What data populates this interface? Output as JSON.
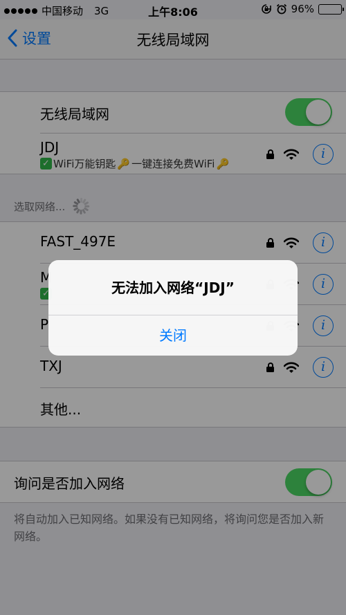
{
  "status_bar": {
    "carrier": "中国移动",
    "network": "3G",
    "time": "上午8:06",
    "battery": "96%",
    "battery_level": 0.96
  },
  "nav": {
    "back_label": "设置",
    "title": "无线局域网"
  },
  "wlan": {
    "label": "无线局域网",
    "enabled": true
  },
  "connected": {
    "ssid": "JDJ",
    "subtitle": "WiFi万能钥匙",
    "subtitle2": "一键连接免费WiFi"
  },
  "choose_network": {
    "header": "选取网络..."
  },
  "networks": [
    {
      "ssid": "FAST_497E"
    },
    {
      "ssid": "M"
    },
    {
      "ssid": "P"
    },
    {
      "ssid": "TXJ"
    }
  ],
  "other": {
    "label": "其他..."
  },
  "ask_to_join": {
    "label": "询问是否加入网络",
    "enabled": true,
    "footer": "将自动加入已知网络。如果没有已知网络，将询问您是否加入新网络。"
  },
  "alert": {
    "title": "无法加入网络“JDJ”",
    "button": "关闭"
  },
  "colors": {
    "accent": "#007aff",
    "toggle_on": "#4cd964"
  }
}
